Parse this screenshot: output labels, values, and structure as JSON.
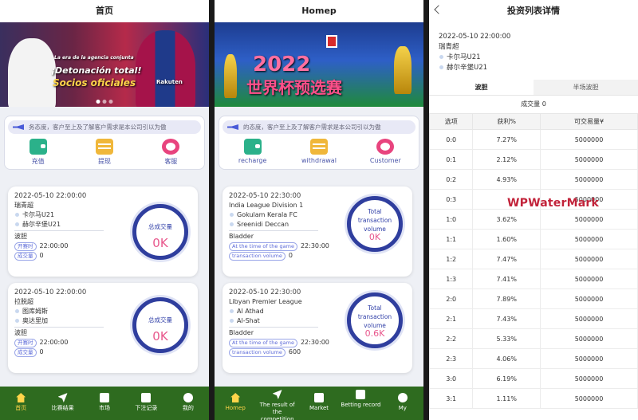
{
  "s1": {
    "title": "首页",
    "banner": {
      "line1": "La era de la agencia conjunta",
      "line2": "¡Detonación total!",
      "line3": "Socios oficiales",
      "sponsor": "Rakuten"
    },
    "notice": "务态度，客户至上及了解客户需求是本公司引以为傲",
    "actions": [
      "充值",
      "提现",
      "客服"
    ],
    "matches": [
      {
        "time": "2022-05-10 22:00:00",
        "league": "瑞青超",
        "team1": "卡尔马U21",
        "team2": "赫尔辛堡U21",
        "market": "波胆",
        "kickoff_label": "开赛时",
        "kickoff": "22:00:00",
        "volume_label": "成交量",
        "volume": "0",
        "ring_label": "总成交量",
        "ring_value": "0K"
      },
      {
        "time": "2022-05-10 22:00:00",
        "league": "拉脱超",
        "team1": "图库姆斯",
        "team2": "奥达里加",
        "market": "波胆",
        "kickoff_label": "开赛时",
        "kickoff": "22:00:00",
        "volume_label": "成交量",
        "volume": "0",
        "ring_label": "总成交量",
        "ring_value": "0K"
      }
    ],
    "tabs": [
      "首页",
      "比赛结果",
      "市场",
      "下注记录",
      "我的"
    ]
  },
  "s2": {
    "title": "Homep",
    "banner": {
      "year": "2022",
      "text": "世界杯预选赛"
    },
    "notice": "的态度，客户至上及了解客户需求是本公司引以为傲",
    "actions": [
      "recharge",
      "withdrawal",
      "Customer"
    ],
    "matches": [
      {
        "time": "2022-05-10 22:30:00",
        "league": "India League Division 1",
        "team1": "Gokulam Kerala FC",
        "team2": "Sreenidi Deccan",
        "market": "Bladder",
        "kickoff_label": "At the time of the game",
        "kickoff": "22:30:00",
        "volume_label": "transaction volume",
        "volume": "0",
        "ring_label": "Total transaction volume",
        "ring_value": "0K"
      },
      {
        "time": "2022-05-10 22:30:00",
        "league": "Libyan Premier League",
        "team1": "Al Athad",
        "team2": "Al-Shat",
        "market": "Bladder",
        "kickoff_label": "At the time of the game",
        "kickoff": "22:30:00",
        "volume_label": "transaction volume",
        "volume": "600",
        "ring_label": "Total transaction volume",
        "ring_value": "0.6K"
      }
    ],
    "tabs": [
      "Homep",
      "The result of the competition",
      "Market",
      "Betting record",
      "My"
    ]
  },
  "s3": {
    "title": "投资列表详情",
    "time": "2022-05-10 22:00:00",
    "league": "瑞青超",
    "team1": "卡尔马U21",
    "team2": "赫尔辛堡U21",
    "tabs": [
      "波胆",
      "半场波胆"
    ],
    "volume": "成交量 0",
    "columns": [
      "选项",
      "获利%",
      "可交易量¥"
    ],
    "rows": [
      [
        "0:0",
        "7.27%",
        "5000000"
      ],
      [
        "0:1",
        "2.12%",
        "5000000"
      ],
      [
        "0:2",
        "4.93%",
        "5000000"
      ],
      [
        "0:3",
        "",
        "5000000"
      ],
      [
        "1:0",
        "3.62%",
        "5000000"
      ],
      [
        "1:1",
        "1.60%",
        "5000000"
      ],
      [
        "1:2",
        "7.47%",
        "5000000"
      ],
      [
        "1:3",
        "7.41%",
        "5000000"
      ],
      [
        "2:0",
        "7.89%",
        "5000000"
      ],
      [
        "2:1",
        "7.43%",
        "5000000"
      ],
      [
        "2:2",
        "5.33%",
        "5000000"
      ],
      [
        "2:3",
        "4.06%",
        "5000000"
      ],
      [
        "3:0",
        "6.19%",
        "5000000"
      ],
      [
        "3:1",
        "1.11%",
        "5000000"
      ]
    ],
    "watermark": "WPWaterMark"
  },
  "colors": {
    "accent": "#2f3e9e",
    "tabbar": "#2e6b1f",
    "ring_value": "#e8578c",
    "watermark": "#c2233a"
  }
}
